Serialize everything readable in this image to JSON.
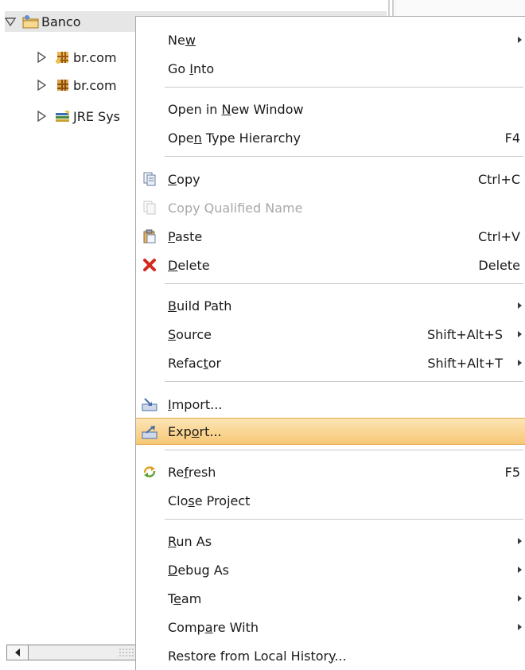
{
  "explorer": {
    "root": {
      "label": "Banco",
      "expanded": true
    },
    "children": [
      {
        "label": "br.com",
        "icon": "package-folder-icon"
      },
      {
        "label": "br.com",
        "icon": "package-icon"
      },
      {
        "label": "JRE Sys",
        "icon": "library-icon"
      }
    ]
  },
  "context_menu": {
    "items": [
      {
        "id": "new",
        "pre": "Ne",
        "mn": "w",
        "post": "",
        "accel": "",
        "submenu": true
      },
      {
        "id": "go-into",
        "pre": "Go ",
        "mn": "I",
        "post": "nto",
        "accel": ""
      },
      {
        "id": "open-new-window",
        "pre": "Open in ",
        "mn": "N",
        "post": "ew Window",
        "accel": ""
      },
      {
        "id": "open-type-hierarchy",
        "pre": "Ope",
        "mn": "n",
        "post": " Type Hierarchy",
        "accel": "F4"
      },
      {
        "id": "copy",
        "pre": "",
        "mn": "C",
        "post": "opy",
        "accel": "Ctrl+C",
        "icon": "copy-icon"
      },
      {
        "id": "copy-qualified-name",
        "pre": "Copy Qualified Name",
        "mn": "",
        "post": "",
        "accel": "",
        "icon": "copy-qualified-icon",
        "disabled": true
      },
      {
        "id": "paste",
        "pre": "",
        "mn": "P",
        "post": "aste",
        "accel": "Ctrl+V",
        "icon": "paste-icon"
      },
      {
        "id": "delete",
        "pre": "",
        "mn": "D",
        "post": "elete",
        "accel": "Delete",
        "icon": "delete-icon"
      },
      {
        "id": "build-path",
        "pre": "",
        "mn": "B",
        "post": "uild Path",
        "accel": "",
        "submenu": true
      },
      {
        "id": "source",
        "pre": "",
        "mn": "S",
        "post": "ource",
        "accel": "Shift+Alt+S",
        "submenu": true
      },
      {
        "id": "refactor",
        "pre": "Refac",
        "mn": "t",
        "post": "or",
        "accel": "Shift+Alt+T",
        "submenu": true
      },
      {
        "id": "import",
        "pre": "",
        "mn": "I",
        "post": "mport...",
        "accel": "",
        "icon": "import-icon"
      },
      {
        "id": "export",
        "pre": "Exp",
        "mn": "o",
        "post": "rt...",
        "accel": "",
        "icon": "export-icon",
        "highlighted": true
      },
      {
        "id": "refresh",
        "pre": "Re",
        "mn": "f",
        "post": "resh",
        "accel": "F5",
        "icon": "refresh-icon"
      },
      {
        "id": "close-project",
        "pre": "Clo",
        "mn": "s",
        "post": "e Project",
        "accel": ""
      },
      {
        "id": "run-as",
        "pre": "",
        "mn": "R",
        "post": "un As",
        "accel": "",
        "submenu": true
      },
      {
        "id": "debug-as",
        "pre": "",
        "mn": "D",
        "post": "ebug As",
        "accel": "",
        "submenu": true
      },
      {
        "id": "team",
        "pre": "T",
        "mn": "e",
        "post": "am",
        "accel": "",
        "submenu": true
      },
      {
        "id": "compare-with",
        "pre": "Comp",
        "mn": "a",
        "post": "re With",
        "accel": "",
        "submenu": true
      },
      {
        "id": "restore-local-history",
        "pre": "Restore from Local Histor",
        "mn": "y",
        "post": "...",
        "accel": ""
      }
    ]
  },
  "colors": {
    "highlight_top": "#fce4b4",
    "highlight_bottom": "#f7c877",
    "disabled_text": "#a8a8a8"
  }
}
